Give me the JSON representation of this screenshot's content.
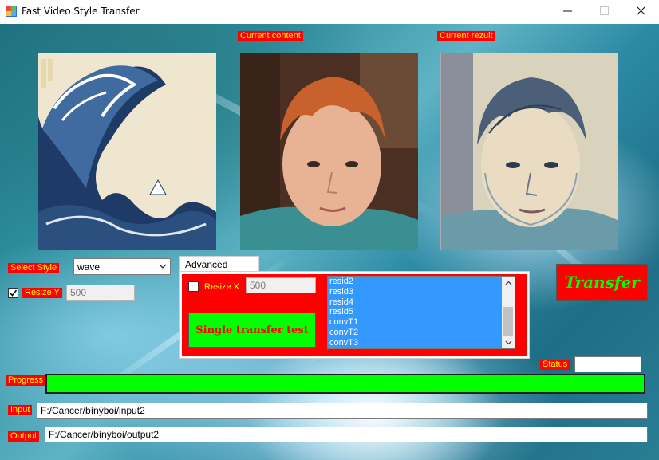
{
  "window": {
    "title": "Fast Video Style Transfer",
    "controls": {
      "minimize": "—",
      "maximize": "☐",
      "close": "✕"
    }
  },
  "labels": {
    "current_content": "Current content",
    "current_result": "Current rezult",
    "select_style": "Select Style",
    "resize_y": "Resize Y",
    "resize_x": "Resize X",
    "status": "Status",
    "progress": "Progress",
    "input": "Input",
    "output": "Output"
  },
  "style_select": {
    "value": "wave"
  },
  "resize_y": {
    "checked": true,
    "value": "500"
  },
  "resize_x": {
    "checked": false,
    "value": "500"
  },
  "advanced": {
    "tab_label": "Advanced options",
    "layers": [
      "resid2",
      "resid3",
      "resid4",
      "resid5",
      "convT1",
      "convT2",
      "convT3"
    ]
  },
  "buttons": {
    "single_test": "Single transfer test",
    "transfer": "Transfer"
  },
  "status_value": "",
  "progress": {
    "fraction": 1.0
  },
  "paths": {
    "input": "F:/Cancer/bínýboi/input2",
    "output": "F:/Cancer/bínýboi/output2"
  },
  "colors": {
    "label_bg": "#ff0000",
    "label_text": "#ffff00",
    "progress_fill": "#00ff00",
    "list_selected": "#3399ff"
  },
  "icons": {
    "app": "app-icon",
    "dropdown": "chevron-down-icon",
    "check": "check-icon",
    "scroll_up": "chevron-up-icon",
    "scroll_down": "chevron-down-icon"
  }
}
